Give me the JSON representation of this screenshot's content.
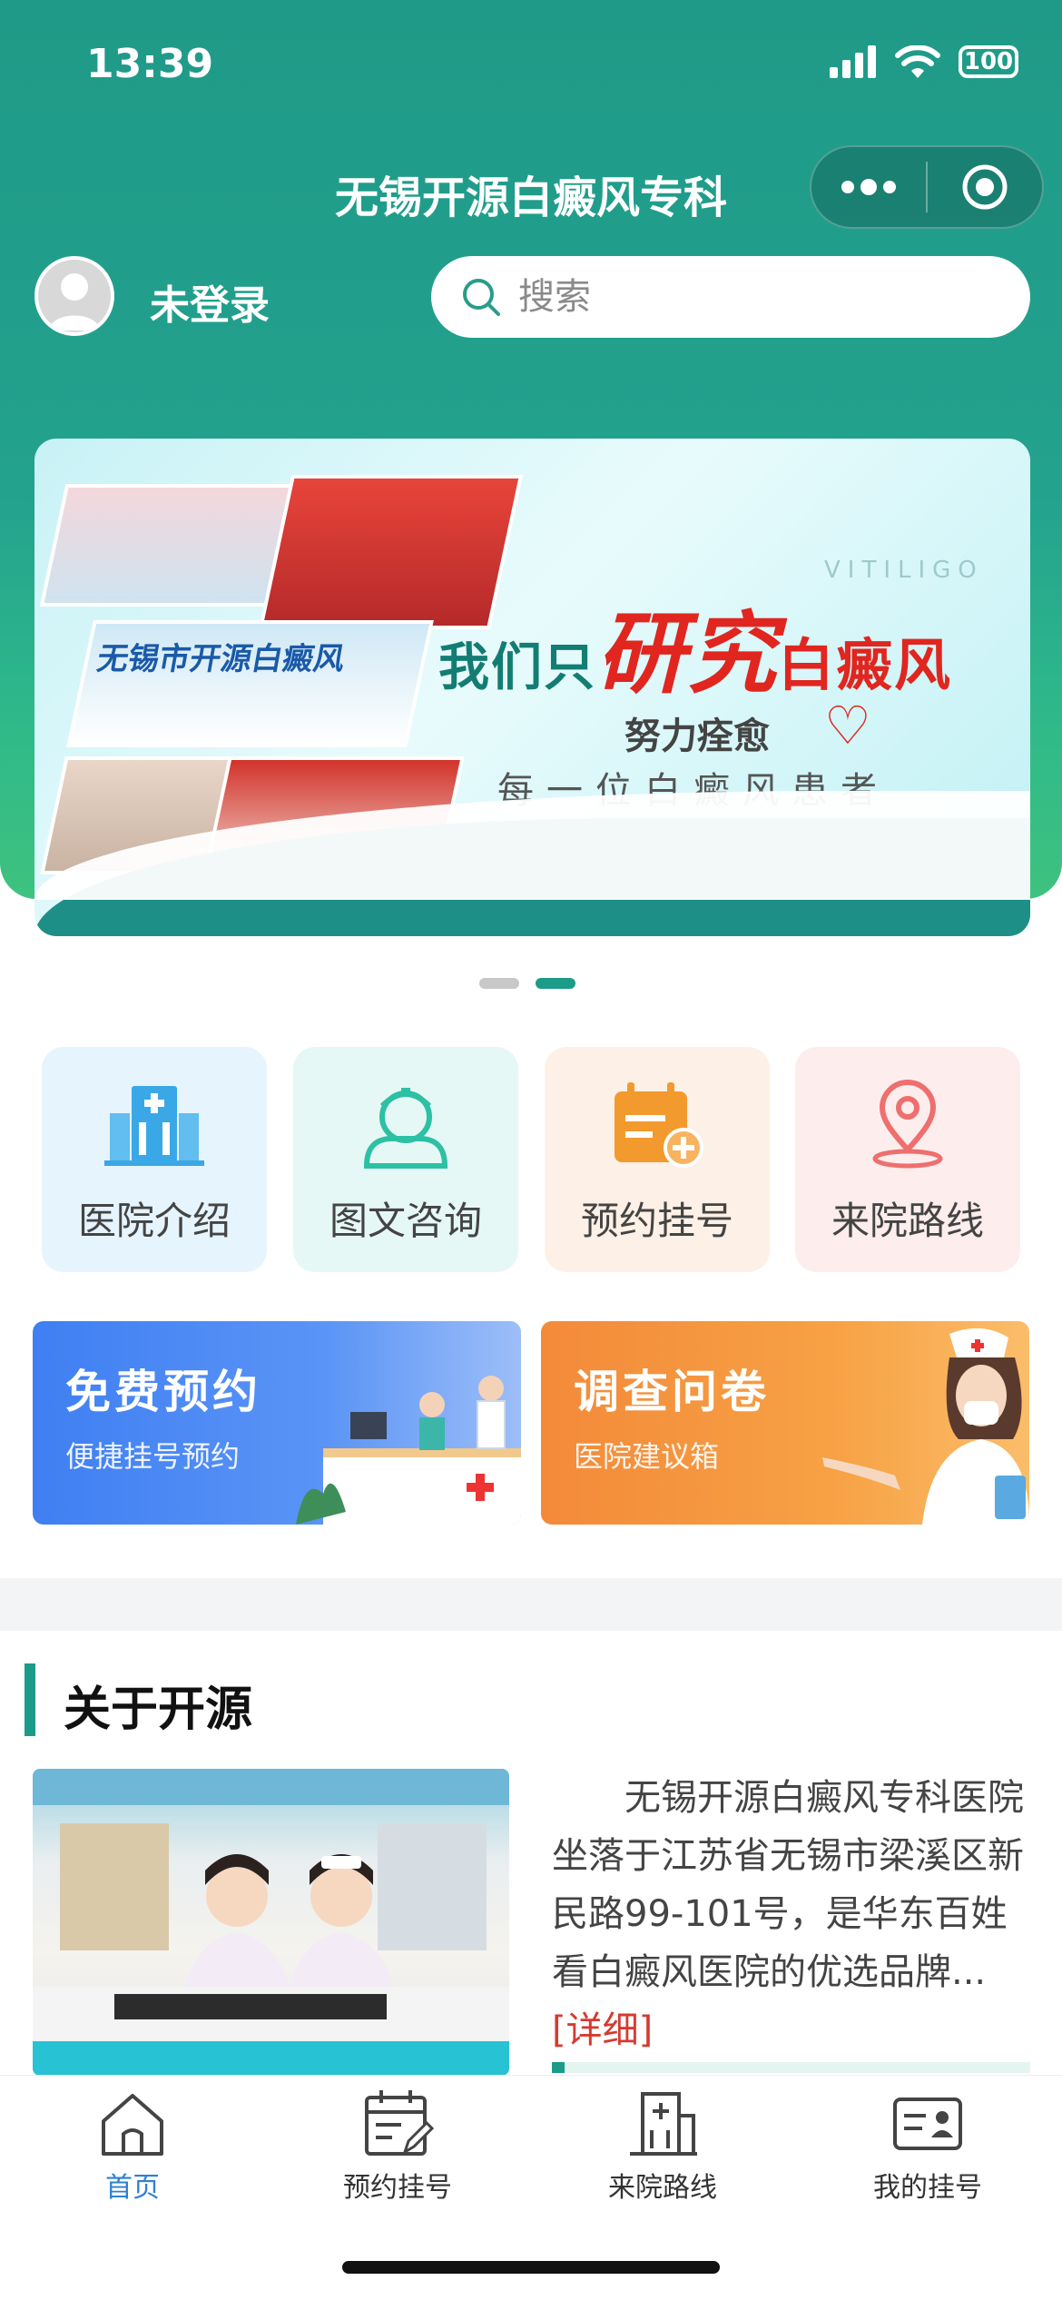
{
  "status_bar": {
    "time": "13:39",
    "battery": "100"
  },
  "header": {
    "title": "无锡开源白癜风专科",
    "login_status": "未登录",
    "search_placeholder": "搜索"
  },
  "banner": {
    "prefix": "我们只",
    "highlight": "研究",
    "suffix": "白癜风",
    "vitiligo": "VITILIGO",
    "line2": "努力痊愈",
    "line3": "每一位白癜风患者",
    "caption": "无锡市开源白癜风",
    "slide_count": 2,
    "active_slide": 2
  },
  "quick_nav": [
    {
      "label": "医院介绍",
      "icon": "hospital-building-icon",
      "bg": "#e6f4fd",
      "color": "#3aa7e6"
    },
    {
      "label": "图文咨询",
      "icon": "nurse-consult-icon",
      "bg": "#e5f8f5",
      "color": "#2cc0a4"
    },
    {
      "label": "预约挂号",
      "icon": "calendar-add-icon",
      "bg": "#fdf0e6",
      "color": "#f39a2e"
    },
    {
      "label": "来院路线",
      "icon": "location-pin-icon",
      "bg": "#fdeded",
      "color": "#ef6e6e"
    }
  ],
  "promo": {
    "left": {
      "title": "免费预约",
      "subtitle": "便捷挂号预约"
    },
    "right": {
      "title": "调查问卷",
      "subtitle": "医院建议箱"
    }
  },
  "about": {
    "title": "关于开源",
    "text": "无锡开源白癜风专科医院坐落于江苏省无锡市梁溪区新民路99-101号，是华东百姓看白癜风医院的优选品牌...",
    "more": "[详细]"
  },
  "tabbar": {
    "items": [
      {
        "label": "首页",
        "active": true
      },
      {
        "label": "预约挂号",
        "active": false
      },
      {
        "label": "来院路线",
        "active": false
      },
      {
        "label": "我的挂号",
        "active": false
      }
    ]
  },
  "colors": {
    "brand": "#1c9b89",
    "tab_active": "#2f7fd6",
    "more_link": "#d63a2f"
  }
}
